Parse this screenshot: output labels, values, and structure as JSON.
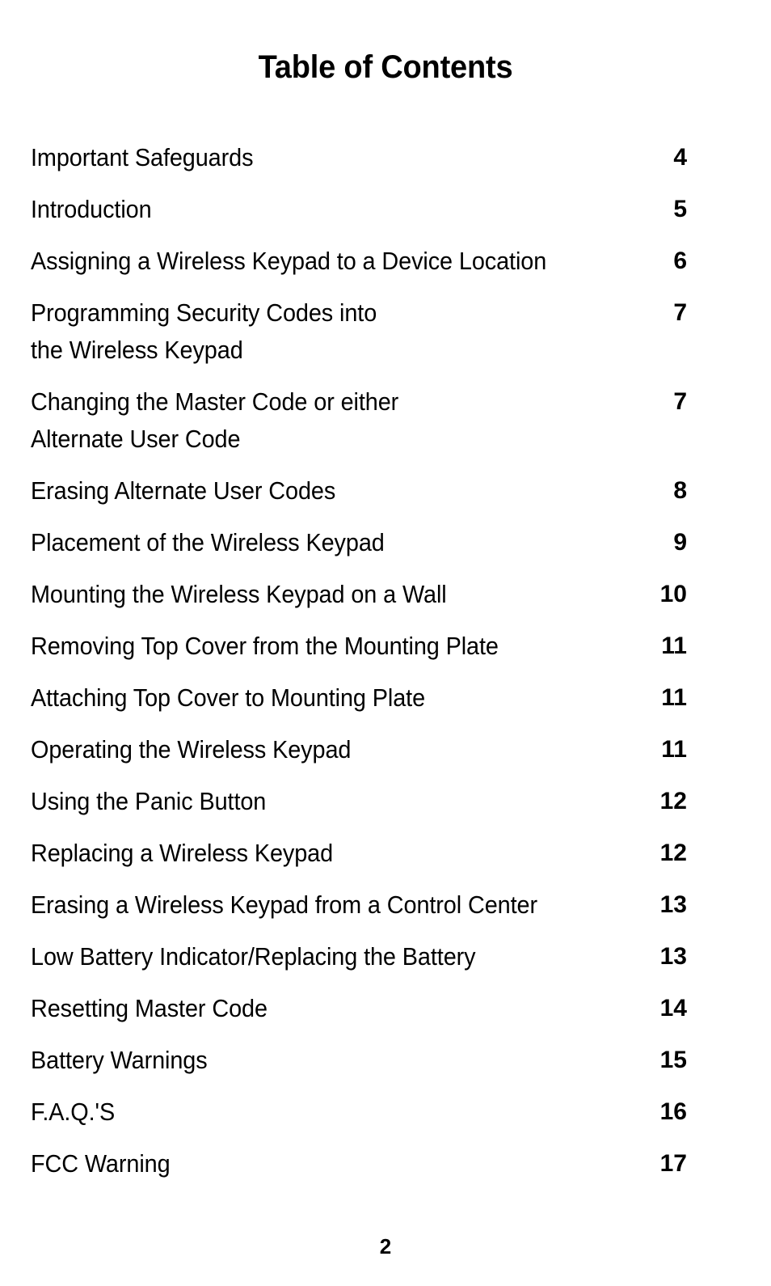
{
  "document": {
    "title": "Table of Contents",
    "page_number": "2"
  },
  "toc": {
    "entries": [
      {
        "label": "Important Safeguards",
        "page": "4"
      },
      {
        "label": "Introduction",
        "page": "5"
      },
      {
        "label": "Assigning a Wireless Keypad to a Device Location",
        "page": "6"
      },
      {
        "label": "Programming Security Codes into\nthe Wireless Keypad",
        "page": "7"
      },
      {
        "label": "Changing the Master Code or either\nAlternate User Code",
        "page": "7"
      },
      {
        "label": "Erasing Alternate User Codes",
        "page": "8"
      },
      {
        "label": "Placement of the Wireless Keypad",
        "page": "9"
      },
      {
        "label": "Mounting the Wireless Keypad on a Wall",
        "page": "10"
      },
      {
        "label": "Removing Top Cover from the Mounting Plate",
        "page": "11"
      },
      {
        "label": "Attaching Top Cover to Mounting Plate",
        "page": "11"
      },
      {
        "label": "Operating the Wireless Keypad",
        "page": "11"
      },
      {
        "label": "Using the Panic Button",
        "page": "12"
      },
      {
        "label": "Replacing a Wireless Keypad",
        "page": "12"
      },
      {
        "label": "Erasing a Wireless Keypad from a Control Center",
        "page": "13"
      },
      {
        "label": "Low Battery Indicator/Replacing the Battery",
        "page": "13"
      },
      {
        "label": "Resetting Master Code",
        "page": "14"
      },
      {
        "label": "Battery Warnings",
        "page": "15"
      },
      {
        "label": "F.A.Q.'S",
        "page": "16"
      },
      {
        "label": "FCC Warning",
        "page": "17"
      }
    ]
  }
}
